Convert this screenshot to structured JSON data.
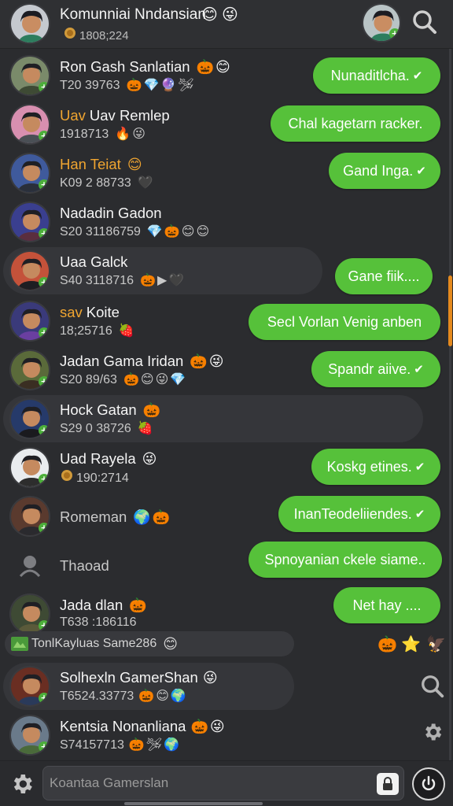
{
  "header": {
    "title": "Komunniai Nndansian",
    "subtitle": "1808;224",
    "title_emojis": [
      "😊",
      "😜"
    ],
    "search_icon": "search-icon"
  },
  "chats": [
    {
      "name": "Ron Gash Sanlatian",
      "meta": "T20 39763",
      "name_emojis": [
        "🎃",
        "😊"
      ],
      "meta_emojis": [
        "🎃",
        "💎",
        "🔮",
        "🛩"
      ],
      "bubble": "Nunaditlcha.",
      "check": true,
      "name_color": "white"
    },
    {
      "name": "Uav Remlep",
      "meta": "1918713",
      "name_emojis": [],
      "meta_emojis": [
        "🔥",
        "😜"
      ],
      "bubble": "Chal kagetarn racker.",
      "check": false,
      "name_color": "white",
      "first_word": "Uav",
      "first_word_color": "orange"
    },
    {
      "name": "Han Teiat",
      "meta": "K09 2 88733",
      "name_emojis": [
        "😊"
      ],
      "meta_emojis": [
        "🖤"
      ],
      "bubble": "Gand Inga.",
      "check": true,
      "name_color": "orange"
    },
    {
      "name": "Nadadin Gadon",
      "meta": "S20 31186759",
      "name_emojis": [],
      "meta_emojis": [
        "💎",
        "🎃",
        "😊",
        "😊"
      ],
      "bubble": "",
      "check": false,
      "name_color": "white"
    },
    {
      "name": "Uaa Galck",
      "meta": "S40 3118716",
      "name_emojis": [],
      "meta_emojis": [
        "🎃",
        "▶",
        "🖤"
      ],
      "bubble": "Gane fiik....",
      "check": false,
      "name_color": "white",
      "pill": true
    },
    {
      "name": "Koite",
      "meta": "18;25716",
      "name_emojis": [],
      "meta_emojis": [
        "🍓"
      ],
      "bubble": "Secl Vorlan Venig anben",
      "check": false,
      "name_color": "white",
      "first_word": "sav",
      "first_word_color": "orange"
    },
    {
      "name": "Jadan Gama Iridan",
      "meta": "S20 89/63",
      "name_emojis": [
        "🎃",
        "😜"
      ],
      "meta_emojis": [
        "🎃",
        "😊",
        "😜",
        "💎"
      ],
      "bubble": "Spandr aiive.",
      "check": true,
      "name_color": "white"
    },
    {
      "name": "Hock Gatan",
      "meta": "S29 0 38726",
      "name_emojis": [
        "🎃"
      ],
      "meta_emojis": [
        "🍓"
      ],
      "bubble": "",
      "check": false,
      "name_color": "white",
      "pill": true
    },
    {
      "name": "Uad Rayela",
      "meta": "190:2714",
      "name_emojis": [
        "😜"
      ],
      "meta_emojis": [],
      "bubble": "Koskg etines.",
      "check": true,
      "name_color": "white",
      "coin": true
    },
    {
      "name": "Romeman",
      "meta": "",
      "name_emojis": [
        "🌍",
        "🎃"
      ],
      "meta_emojis": [],
      "bubble": "InanTeodeliiendes.",
      "check": true,
      "name_color": "dim"
    },
    {
      "name": "Thaoad",
      "meta": "",
      "name_emojis": [],
      "meta_emojis": [],
      "bubble": "Spnoyanian ckele siame..",
      "check": false,
      "name_color": "dim"
    },
    {
      "name": "Jada dlan",
      "meta": "T638 :186116",
      "name_emojis": [
        "🎃"
      ],
      "meta_emojis": [],
      "bubble": "Net hay ....",
      "check": false,
      "name_color": "white"
    }
  ],
  "group_bar": {
    "label": "TonlKayluas Same286",
    "emoji": "😊",
    "right_emojis": [
      "🎃",
      "⭐",
      "🦅"
    ]
  },
  "lower_chats": [
    {
      "name": "Solhexln GamerShan",
      "meta": "T6524.33773",
      "name_emojis": [
        "😜"
      ],
      "meta_emojis": [
        "🎃",
        "😊",
        "🌍"
      ]
    },
    {
      "name": "Kentsia Nonanliana",
      "meta": "S74157713",
      "name_emojis": [
        "🎃",
        "😜"
      ],
      "meta_emojis": [
        "🎃",
        "🛩",
        "🌍"
      ]
    }
  ],
  "composer": {
    "placeholder": "Koantaa Gamerslan"
  },
  "colors": {
    "bubble_green": "#56c13a",
    "accent_orange": "#f0a530",
    "background": "#2b2c2f"
  }
}
